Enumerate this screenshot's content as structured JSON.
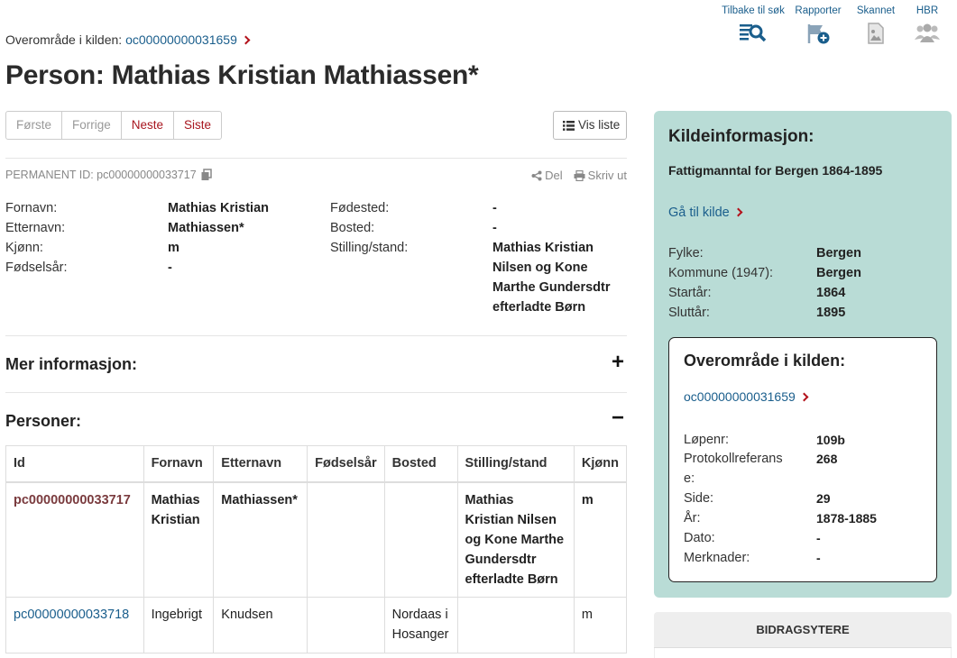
{
  "breadcrumb": {
    "label": "Overområde i kilden:",
    "link": "oc00000000031659"
  },
  "top_nav": [
    {
      "label": "Tilbake til søk",
      "icon": "search-list-icon"
    },
    {
      "label": "Rapporter",
      "icon": "flag-plus-icon"
    },
    {
      "label": "Skannet",
      "icon": "scanned-image-icon"
    },
    {
      "label": "HBR",
      "icon": "people-group-icon"
    }
  ],
  "title": "Person: Mathias Kristian Mathiassen*",
  "pager": {
    "first": "Første",
    "prev": "Forrige",
    "next": "Neste",
    "last": "Siste"
  },
  "vis_liste": "Vis liste",
  "permanent_id": "PERMANENT ID: pc00000000033717",
  "share": "Del",
  "print": "Skriv ut",
  "person": {
    "fornavn_label": "Fornavn:",
    "fornavn": "Mathias Kristian",
    "etternavn_label": "Etternavn:",
    "etternavn": "Mathiassen*",
    "kjonn_label": "Kjønn:",
    "kjonn": "m",
    "fodselsar_label": "Fødselsår:",
    "fodselsar": "-",
    "fodested_label": "Fødested:",
    "fodested": "-",
    "bosted_label": "Bosted:",
    "bosted": "-",
    "stilling_label": "Stilling/stand:",
    "stilling_lines": [
      "Mathias Kristian",
      "Nilsen og Kone",
      "Marthe Gundersdtr",
      "efterladte Børn"
    ]
  },
  "sections": {
    "mer_info": "Mer informasjon:",
    "personer": "Personer:",
    "plus": "+",
    "minus": "−"
  },
  "table": {
    "headers": [
      "Id",
      "Fornavn",
      "Etternavn",
      "Fødselsår",
      "Bosted",
      "Stilling/stand",
      "Kjønn"
    ],
    "rows": [
      {
        "id": "pc00000000033717",
        "fornavn": [
          "Mathias",
          "Kristian"
        ],
        "etternavn": "Mathiassen*",
        "fodselsar": "",
        "bosted": [],
        "stilling": [
          "Mathias",
          "Kristian Nilsen",
          "og Kone Marthe",
          "Gundersdtr",
          "efterladte Børn"
        ],
        "kjonn": "m"
      },
      {
        "id": "pc00000000033718",
        "fornavn": [
          "Ingebrigt"
        ],
        "etternavn": "Knudsen",
        "fodselsar": "",
        "bosted": [
          "Nordaas i",
          "Hosanger"
        ],
        "stilling": [],
        "kjonn": "m"
      }
    ]
  },
  "kilde": {
    "title": "Kildeinformasjon:",
    "name": "Fattigmanntal for Bergen 1864-1895",
    "link": "Gå til kilde",
    "fields": [
      {
        "label": "Fylke:",
        "value": "Bergen"
      },
      {
        "label": "Kommune (1947):",
        "value": "Bergen"
      },
      {
        "label": "Startår:",
        "value": "1864"
      },
      {
        "label": "Sluttår:",
        "value": "1895"
      }
    ],
    "overomrade": {
      "title": "Overområde i kilden:",
      "link": "oc00000000031659",
      "fields": [
        {
          "label": "Løpenr:",
          "value": "109b"
        },
        {
          "label": "Protokollreferans",
          "label2": "e:",
          "value": "268"
        },
        {
          "label": "Side:",
          "value": "29"
        },
        {
          "label": "År:",
          "value": "1878-1885"
        },
        {
          "label": "Dato:",
          "value": "-"
        },
        {
          "label": "Merknader:",
          "value": "-"
        }
      ]
    }
  },
  "bidrag": "BIDRAGSYTERE",
  "colors": {
    "accent": "#b3121b",
    "link": "#1a5e8c",
    "panel": "#b9dcd6"
  }
}
